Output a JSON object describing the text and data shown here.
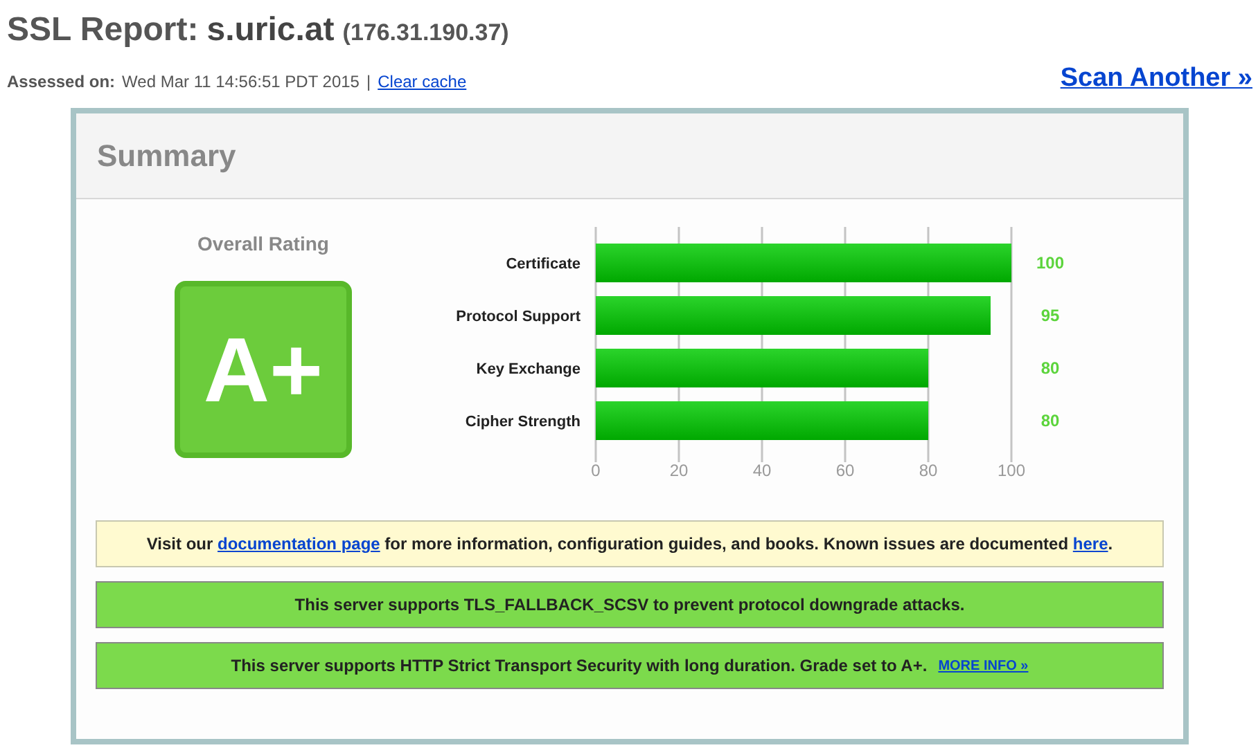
{
  "header": {
    "title_prefix": "SSL Report:",
    "host": "s.uric.at",
    "ip": "(176.31.190.37)",
    "assessed_label": "Assessed on:",
    "assessed_value": "Wed Mar 11 14:56:51 PDT 2015",
    "separator": "|",
    "clear_cache": "Clear cache",
    "scan_another": "Scan Another »"
  },
  "summary": {
    "title": "Summary",
    "rating_label": "Overall Rating",
    "grade": "A+",
    "chart_data": {
      "type": "bar",
      "orientation": "horizontal",
      "categories": [
        "Certificate",
        "Protocol Support",
        "Key Exchange",
        "Cipher Strength"
      ],
      "series": [
        {
          "color": "#11bb11",
          "values": [
            100,
            95,
            80,
            80
          ]
        }
      ],
      "xlim": [
        0,
        100
      ],
      "xticks": [
        0,
        20,
        40,
        60,
        80,
        100
      ],
      "grid": true,
      "data_labels": true
    }
  },
  "notices": [
    {
      "kind": "info",
      "parts": [
        {
          "kind": "text",
          "text": "Visit our "
        },
        {
          "kind": "link",
          "text": "documentation page"
        },
        {
          "kind": "text",
          "text": " for more information, configuration guides, and books. Known issues are documented "
        },
        {
          "kind": "link",
          "text": "here"
        },
        {
          "kind": "text",
          "text": "."
        }
      ]
    },
    {
      "kind": "good",
      "parts": [
        {
          "kind": "text",
          "text": "This server supports TLS_FALLBACK_SCSV to prevent protocol downgrade attacks."
        }
      ]
    },
    {
      "kind": "good",
      "parts": [
        {
          "kind": "text",
          "text": "This server supports HTTP Strict Transport Security with long duration. Grade set to A+."
        }
      ],
      "more": "MORE INFO »"
    }
  ]
}
